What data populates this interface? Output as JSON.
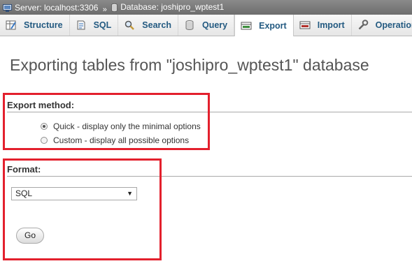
{
  "breadcrumb": {
    "server": "Server: localhost:3306",
    "separator": "»",
    "database": "Database: joshipro_wptest1"
  },
  "tabs": [
    {
      "label": "Structure",
      "icon": "structure-icon",
      "active": false
    },
    {
      "label": "SQL",
      "icon": "sql-icon",
      "active": false
    },
    {
      "label": "Search",
      "icon": "search-icon",
      "active": false
    },
    {
      "label": "Query",
      "icon": "query-icon",
      "active": false
    },
    {
      "label": "Export",
      "icon": "export-icon",
      "active": true
    },
    {
      "label": "Import",
      "icon": "import-icon",
      "active": false
    },
    {
      "label": "Operations",
      "icon": "operations-icon",
      "active": false
    }
  ],
  "page": {
    "title": "Exporting tables from \"joshipro_wptest1\" database"
  },
  "export_method": {
    "heading": "Export method:",
    "options": [
      {
        "label": "Quick - display only the minimal options",
        "checked": true
      },
      {
        "label": "Custom - display all possible options",
        "checked": false
      }
    ]
  },
  "format": {
    "heading": "Format:",
    "selected": "SQL"
  },
  "go_label": "Go",
  "colors": {
    "highlight": "#e3202d",
    "tab_text": "#235a81",
    "topbar": "#7a7a7a"
  }
}
